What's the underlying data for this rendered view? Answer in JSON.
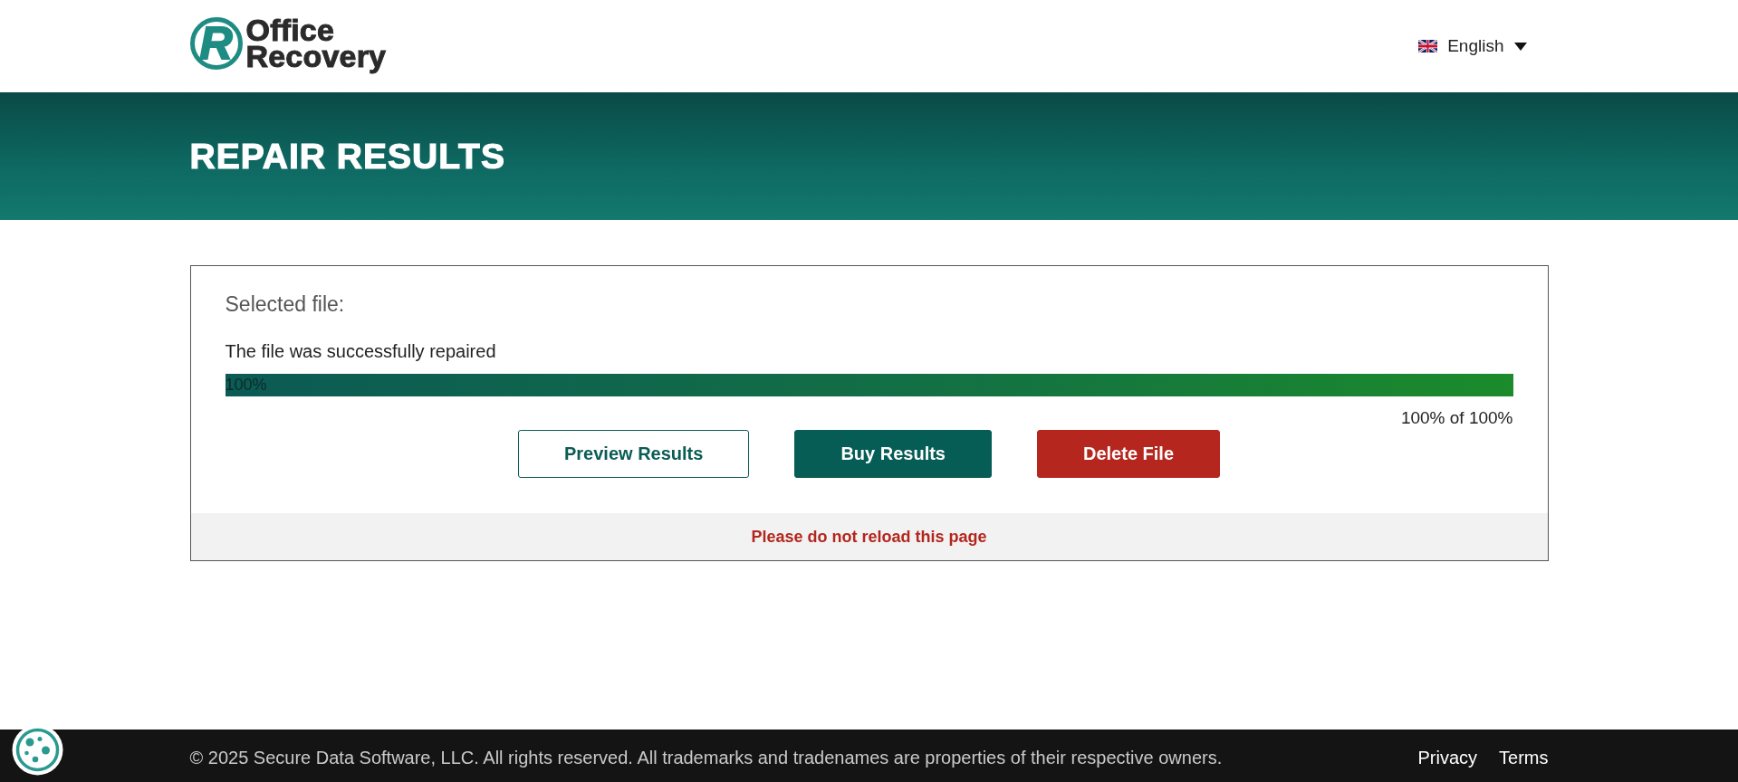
{
  "header": {
    "logo": {
      "mark": "R",
      "line1": "Office",
      "line2": "Recovery"
    },
    "language": {
      "label": "English"
    }
  },
  "banner": {
    "title": "REPAIR RESULTS"
  },
  "card": {
    "heading": "Selected file:",
    "status": "The file was successfully repaired",
    "progress": {
      "level": 1,
      "label": "100%",
      "reading": "100% of 100%"
    },
    "buttons": [
      {
        "label": "Preview Results",
        "kind": "outline"
      },
      {
        "label": "Buy Results",
        "kind": "primary"
      },
      {
        "label": "Delete File",
        "kind": "danger"
      }
    ],
    "notice": "Please do not reload this page"
  },
  "footer": {
    "copyright": "© 2025 Secure Data Software, LLC. All rights reserved. All trademarks and tradenames are properties of their respective owners.",
    "links": [
      "Privacy",
      "Terms"
    ]
  }
}
